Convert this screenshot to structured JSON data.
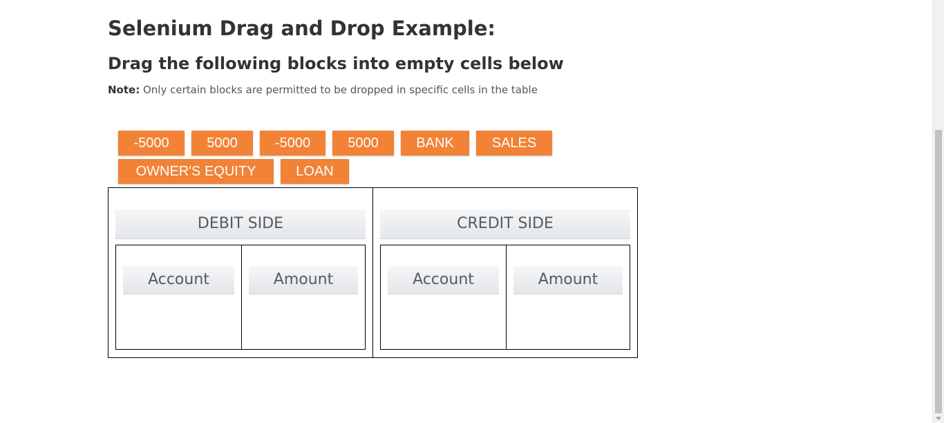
{
  "heading": {
    "title": "Selenium Drag and Drop Example:",
    "subtitle": "Drag the following blocks into empty cells below",
    "note_label": "Note:",
    "note_text": " Only certain blocks are permitted to be dropped in specific cells in the table"
  },
  "blocks": [
    {
      "label": "-5000"
    },
    {
      "label": "5000"
    },
    {
      "label": "-5000"
    },
    {
      "label": "5000"
    },
    {
      "label": "BANK"
    },
    {
      "label": "SALES"
    },
    {
      "label": "OWNER'S EQUITY"
    },
    {
      "label": "LOAN"
    }
  ],
  "ledger": {
    "debit": {
      "title": "DEBIT SIDE",
      "account_label": "Account",
      "amount_label": "Amount"
    },
    "credit": {
      "title": "CREDIT SIDE",
      "account_label": "Account",
      "amount_label": "Amount"
    }
  },
  "colors": {
    "block": "#f18236",
    "header_text": "#555b60"
  }
}
